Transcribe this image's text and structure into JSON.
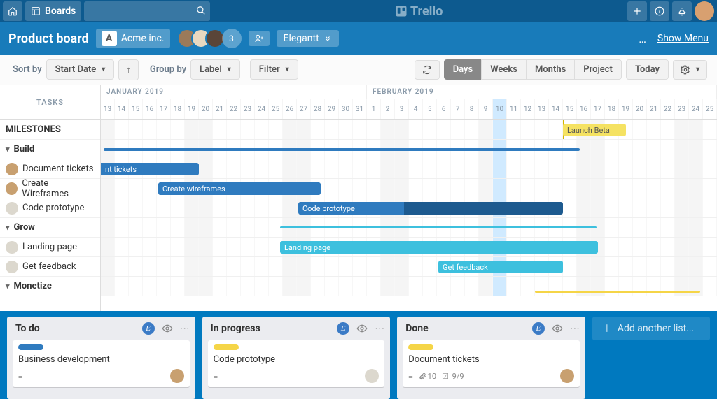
{
  "header": {
    "boards_label": "Boards",
    "logo_text": "Trello"
  },
  "board": {
    "title": "Product board",
    "org_letter": "A",
    "org_name": "Acme inc.",
    "member_count": "3",
    "powerup_label": "Elegantt",
    "show_menu": "Show Menu",
    "menu_dots": "…"
  },
  "toolbar": {
    "sort_by": "Sort by",
    "sort_value": "Start Date",
    "group_by": "Group by",
    "group_value": "Label",
    "filter": "Filter",
    "views": {
      "days": "Days",
      "weeks": "Weeks",
      "months": "Months",
      "project": "Project"
    },
    "today": "Today"
  },
  "gantt": {
    "tasks_header": "TASKS",
    "months": {
      "jan": "JANUARY 2019",
      "feb": "FEBRUARY 2019"
    },
    "days": [
      "13",
      "14",
      "15",
      "16",
      "17",
      "18",
      "19",
      "20",
      "21",
      "22",
      "23",
      "24",
      "25",
      "26",
      "27",
      "28",
      "29",
      "30",
      "31",
      "1",
      "2",
      "3",
      "4",
      "5",
      "6",
      "7",
      "8",
      "9",
      "10",
      "11",
      "12",
      "13",
      "14",
      "15",
      "16",
      "17",
      "18",
      "19",
      "20",
      "21",
      "22",
      "23",
      "24",
      "25"
    ],
    "rows": {
      "milestones": "MILESTONES",
      "build": "Build",
      "doc_tickets": "Document tickets",
      "wireframes": "Create Wireframes",
      "code_proto": "Code prototype",
      "grow": "Grow",
      "landing": "Landing page",
      "feedback": "Get feedback",
      "monetize": "Monetize"
    },
    "bars": {
      "launch_beta": "Launch Beta",
      "nt_tickets": "nt tickets",
      "create_wireframes": "Create wireframes",
      "code_prototype": "Code prototype",
      "landing_page": "Landing page",
      "get_feedback": "Get feedback"
    }
  },
  "lists": {
    "todo": {
      "title": "To do",
      "card": {
        "title": "Business development",
        "label_color": "#2f7bbf"
      }
    },
    "inprogress": {
      "title": "In progress",
      "card": {
        "title": "Code prototype",
        "label_color": "#f5d547"
      }
    },
    "done": {
      "title": "Done",
      "card": {
        "title": "Document tickets",
        "label_color": "#f5d547",
        "attach": "10",
        "check": "9/9"
      }
    },
    "add_list": "Add another list..."
  }
}
